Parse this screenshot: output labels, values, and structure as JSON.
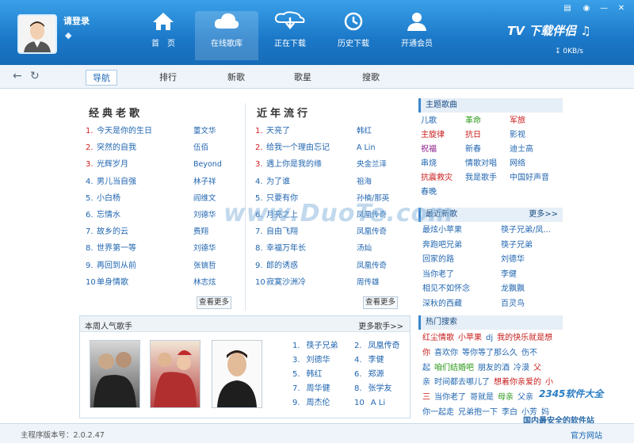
{
  "header": {
    "login_label": "请登录",
    "nav": [
      {
        "label": "首　页",
        "icon": "home-icon"
      },
      {
        "label": "在线歌库",
        "icon": "cloud-icon"
      },
      {
        "label": "正在下载",
        "icon": "download-cloud-icon"
      },
      {
        "label": "历史下载",
        "icon": "history-icon"
      },
      {
        "label": "开通会员",
        "icon": "member-icon"
      }
    ],
    "active_nav": 1,
    "logo": "下载伴侣",
    "speed": "0KB/s"
  },
  "toolbar": {
    "tabs": [
      "导航",
      "排行",
      "新歌",
      "歌星",
      "搜歌"
    ],
    "active_tab": 0
  },
  "classic": {
    "title": "经典老歌",
    "more": "查看更多",
    "songs": [
      {
        "num": "1.",
        "name": "今天是你的生日",
        "artist": "董文华"
      },
      {
        "num": "2.",
        "name": "突然的自我",
        "artist": "伍佰"
      },
      {
        "num": "3.",
        "name": "光辉岁月",
        "artist": "Beyond"
      },
      {
        "num": "4.",
        "name": "男儿当自强",
        "artist": "林子祥"
      },
      {
        "num": "5.",
        "name": "小白杨",
        "artist": "阎维文"
      },
      {
        "num": "6.",
        "name": "忘情水",
        "artist": "刘德华"
      },
      {
        "num": "7.",
        "name": "故乡的云",
        "artist": "费翔"
      },
      {
        "num": "8.",
        "name": "世界第一等",
        "artist": "刘德华"
      },
      {
        "num": "9.",
        "name": "再回到从前",
        "artist": "张镐哲"
      },
      {
        "num": "10",
        "name": "单身情歌",
        "artist": "林志炫"
      }
    ]
  },
  "popular": {
    "title": "近年流行",
    "more": "查看更多",
    "songs": [
      {
        "num": "1.",
        "name": "天亮了",
        "artist": "韩红"
      },
      {
        "num": "2.",
        "name": "给我一个理由忘记",
        "artist": "A Lin"
      },
      {
        "num": "3.",
        "name": "遇上你是我的缘",
        "artist": "央金兰泽"
      },
      {
        "num": "4.",
        "name": "为了谁",
        "artist": "祖海"
      },
      {
        "num": "5.",
        "name": "只要有你",
        "artist": "孙楠/那英"
      },
      {
        "num": "6.",
        "name": "月亮之上",
        "artist": "凤凰传奇"
      },
      {
        "num": "7.",
        "name": "自由飞翔",
        "artist": "凤凰传奇"
      },
      {
        "num": "8.",
        "name": "幸福万年长",
        "artist": "汤灿"
      },
      {
        "num": "9.",
        "name": "郎的诱惑",
        "artist": "凤凰传奇"
      },
      {
        "num": "10",
        "name": "寂寞沙洲冷",
        "artist": "周传雄"
      }
    ]
  },
  "singers": {
    "title": "本周人气歌手",
    "more": "更多歌手>>",
    "list": [
      {
        "num": "1.",
        "name": "筷子兄弟"
      },
      {
        "num": "2.",
        "name": "凤凰传奇"
      },
      {
        "num": "3.",
        "name": "刘德华"
      },
      {
        "num": "4.",
        "name": "李健"
      },
      {
        "num": "5.",
        "name": "韩红"
      },
      {
        "num": "6.",
        "name": "郑源"
      },
      {
        "num": "7.",
        "name": "周华健"
      },
      {
        "num": "8.",
        "name": "张学友"
      },
      {
        "num": "9.",
        "name": "周杰伦"
      },
      {
        "num": "10",
        "name": "A Li"
      }
    ]
  },
  "right": {
    "themes_title": "主题歌曲",
    "themes": [
      {
        "t": "儿歌",
        "c": ""
      },
      {
        "t": "革命",
        "c": "green"
      },
      {
        "t": "军旅",
        "c": "red"
      },
      {
        "t": "主旋律",
        "c": "red"
      },
      {
        "t": "抗日",
        "c": "red"
      },
      {
        "t": "影视",
        "c": ""
      },
      {
        "t": "祝福",
        "c": "purple"
      },
      {
        "t": "新春",
        "c": ""
      },
      {
        "t": "迪士高",
        "c": ""
      },
      {
        "t": "串烧",
        "c": ""
      },
      {
        "t": "情歌对唱",
        "c": ""
      },
      {
        "t": "网络",
        "c": ""
      },
      {
        "t": "抗震救灾",
        "c": "red"
      },
      {
        "t": "我是歌手",
        "c": ""
      },
      {
        "t": "中国好声音",
        "c": ""
      },
      {
        "t": "春晚",
        "c": ""
      }
    ],
    "new_title": "最近新歌",
    "new_more": "更多>>",
    "new_songs": [
      "最炫小苹果",
      "筷子兄弟/凤...",
      "奔跑吧兄弟",
      "筷子兄弟",
      "回家的路",
      "刘德华",
      "当你老了",
      "李健",
      "相见不如怀念",
      "龙飘飘",
      "深秋的西藏",
      "百灵鸟"
    ],
    "hot_title": "热门搜索",
    "hot_lines": [
      [
        {
          "t": "红尘情歌",
          "c": "red"
        },
        {
          "t": "小苹果",
          "c": "red"
        },
        {
          "t": "dj",
          "c": ""
        },
        {
          "t": "我的快乐就是想",
          "c": "red"
        }
      ],
      [
        {
          "t": "你",
          "c": "red"
        },
        {
          "t": "喜欢你",
          "c": ""
        },
        {
          "t": "等你等了那么久",
          "c": ""
        },
        {
          "t": "伤不",
          "c": ""
        }
      ],
      [
        {
          "t": "起",
          "c": ""
        },
        {
          "t": "咱们结婚吧",
          "c": "green"
        },
        {
          "t": "朋友的酒",
          "c": ""
        },
        {
          "t": "冷漠",
          "c": ""
        },
        {
          "t": "父",
          "c": "red"
        }
      ],
      [
        {
          "t": "亲",
          "c": ""
        },
        {
          "t": "时间都去哪儿了",
          "c": ""
        },
        {
          "t": "想着你亲爱的",
          "c": "red"
        },
        {
          "t": "小",
          "c": "red"
        }
      ],
      [
        {
          "t": "三",
          "c": "red"
        },
        {
          "t": "当你老了",
          "c": ""
        },
        {
          "t": "哥就是",
          "c": ""
        },
        {
          "t": "母亲",
          "c": "green"
        },
        {
          "t": "父亲",
          "c": ""
        }
      ],
      [
        {
          "t": "你一起走",
          "c": ""
        },
        {
          "t": "兄弟抱一下",
          "c": ""
        },
        {
          "t": "李白",
          "c": ""
        },
        {
          "t": "小芳",
          "c": ""
        },
        {
          "t": "妈",
          "c": ""
        }
      ]
    ]
  },
  "status": {
    "version": "主程序版本号：2.0.2.47",
    "official": "官方网站"
  },
  "watermarks": {
    "center": "www.DuoTe.com",
    "corner": "2345软件大全",
    "corner_sub": "国内最安全的软件站"
  }
}
